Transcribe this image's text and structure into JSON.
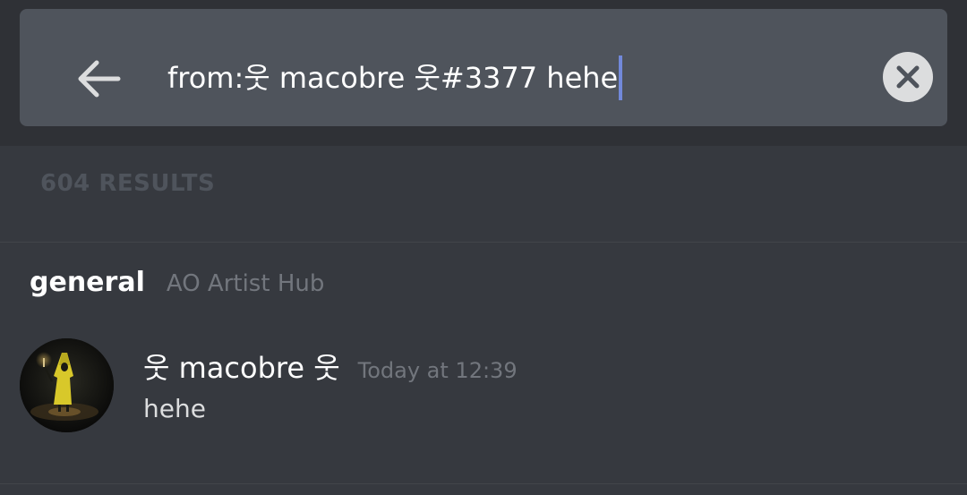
{
  "search": {
    "query": "from:웃 macobre 웃#3377 hehe"
  },
  "results": {
    "count_label": "604 RESULTS"
  },
  "channel": {
    "name": "general",
    "server": "AO Artist Hub"
  },
  "message": {
    "author": "웃 macobre 웃",
    "timestamp": "Today at 12:39",
    "content": "hehe"
  },
  "colors": {
    "background": "#36393f",
    "header_background": "#2f3136",
    "search_box": "#4f545c",
    "caret": "#7289da",
    "muted_text": "#72767d"
  },
  "icons": {
    "back": "arrow-left-icon",
    "clear": "close-icon"
  }
}
